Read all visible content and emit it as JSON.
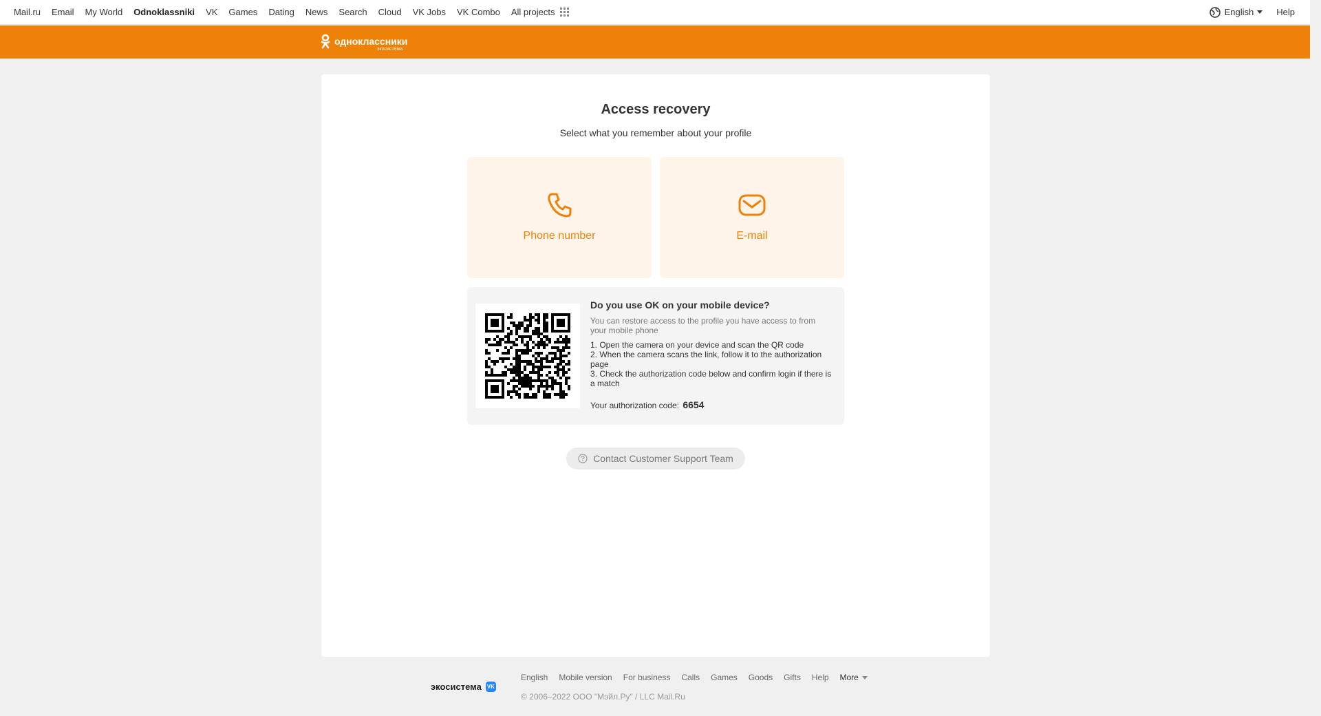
{
  "portal_bar": {
    "links": [
      "Mail.ru",
      "Email",
      "My World",
      "Odnoklassniki",
      "VK",
      "Games",
      "Dating",
      "News",
      "Search",
      "Cloud",
      "VK Jobs",
      "VK Combo",
      "All projects"
    ],
    "active": "Odnoklassniki",
    "language": "English",
    "help": "Help"
  },
  "header": {
    "logo_text": "одноклассники",
    "logo_sub": "экосистема",
    "color": "#ee8208"
  },
  "recovery": {
    "title": "Access recovery",
    "subtitle": "Select what you remember about your profile",
    "options": [
      {
        "label": "Phone number",
        "icon": "phone-icon"
      },
      {
        "label": "E-mail",
        "icon": "envelope-icon"
      }
    ]
  },
  "qr": {
    "title": "Do you use OK on your mobile device?",
    "description": "You can restore access to the profile you have access to from your mobile phone",
    "steps": [
      "1. Open the camera on your device and scan the QR code",
      "2. When the camera scans the link, follow it to the authorization page",
      "3. Check the authorization code below and confirm login if there is a match"
    ],
    "auth_label": "Your authorization code:",
    "auth_code": "6654"
  },
  "support": {
    "label": "Contact Customer Support Team"
  },
  "footer": {
    "eco_logo": "экосистема",
    "vk_badge": "VK",
    "links": [
      "English",
      "Mobile version",
      "For business",
      "Calls",
      "Games",
      "Goods",
      "Gifts",
      "Help"
    ],
    "more": "More",
    "copyright": "© 2006–2022 ООО \"Мэйл.Ру\" / LLC Mail.Ru"
  }
}
